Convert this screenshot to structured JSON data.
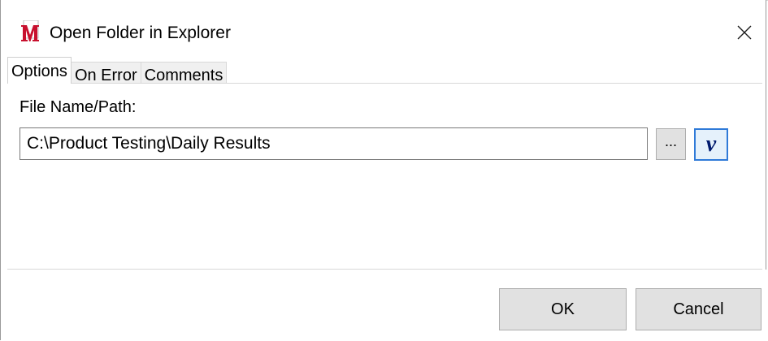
{
  "window": {
    "title": "Open Folder in Explorer",
    "app_icon": "m-logo-icon",
    "close_icon": "close-icon"
  },
  "tabs": [
    {
      "label": "Options",
      "active": true
    },
    {
      "label": "On Error",
      "active": false
    },
    {
      "label": "Comments",
      "active": false
    }
  ],
  "options": {
    "path_label": "File Name/Path:",
    "path_value": "C:\\Product Testing\\Daily Results",
    "browse_label": "...",
    "variable_label": "v"
  },
  "footer": {
    "ok_label": "OK",
    "cancel_label": "Cancel"
  },
  "colors": {
    "logo_red": "#c8102e",
    "focus_border": "#2f7ad8",
    "button_face": "#e1e1e1"
  }
}
